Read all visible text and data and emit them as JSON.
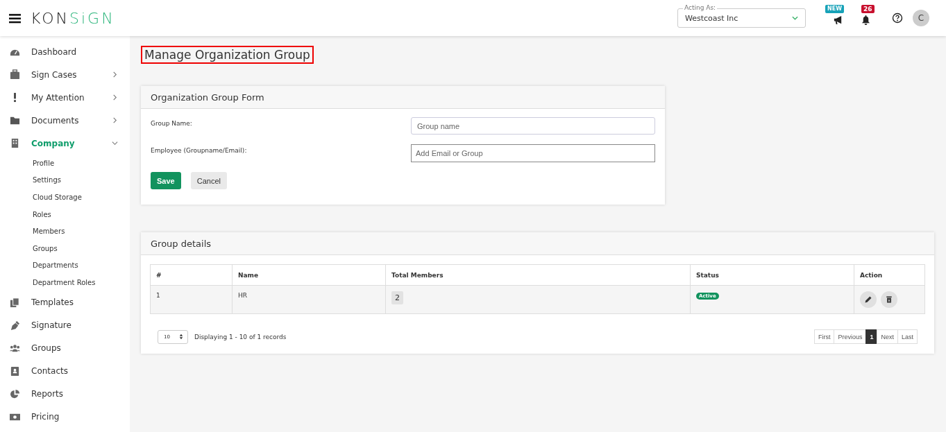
{
  "header": {
    "logo": {
      "dark": "KON",
      "accent": "SiGN"
    },
    "acting_as": {
      "label": "Acting As:",
      "value": "Westcoast Inc"
    },
    "announcement_badge": "NEW",
    "notification_count": "26",
    "avatar": "C"
  },
  "sidebar": {
    "items": [
      {
        "label": "Dashboard",
        "kind": "dashboard",
        "selected": false
      },
      {
        "label": "Sign Cases",
        "kind": "case",
        "expanded": false,
        "selected": false
      },
      {
        "label": "My Attention",
        "kind": "exclamation",
        "expanded": false,
        "selected": false
      },
      {
        "label": "Documents",
        "kind": "folder",
        "expanded": false,
        "selected": false
      },
      {
        "label": "Company",
        "kind": "building",
        "expanded": true,
        "selected": true,
        "children": [
          {
            "label": "Profile"
          },
          {
            "label": "Settings"
          },
          {
            "label": "Cloud Storage"
          },
          {
            "label": "Roles"
          },
          {
            "label": "Members"
          },
          {
            "label": "Groups"
          },
          {
            "label": "Departments"
          },
          {
            "label": "Department Roles"
          }
        ]
      },
      {
        "label": "Templates",
        "kind": "copy",
        "selected": false
      },
      {
        "label": "Signature",
        "kind": "pen",
        "selected": false
      },
      {
        "label": "Groups",
        "kind": "users",
        "selected": false
      },
      {
        "label": "Contacts",
        "kind": "contact",
        "selected": false
      },
      {
        "label": "Reports",
        "kind": "pie",
        "selected": false
      },
      {
        "label": "Pricing",
        "kind": "money",
        "selected": false
      }
    ]
  },
  "page_title": "Manage Organization Group",
  "form": {
    "title": "Organization Group Form",
    "fields": [
      {
        "label": "Group Name:",
        "placeholder": "Group name"
      },
      {
        "label": "Employee (Groupname/Email):",
        "placeholder": "Add Email or Group"
      }
    ],
    "buttons": [
      {
        "label": "Save",
        "kind": "primary"
      },
      {
        "label": "Cancel",
        "kind": "secondary"
      }
    ]
  },
  "group_details": {
    "title": "Group details",
    "table": {
      "columns": [
        "#",
        "Name",
        "Total Members",
        "Status",
        "Action"
      ],
      "rows": [
        {
          "index": "1",
          "name": "HR",
          "total_members": "2",
          "status": "Active"
        }
      ]
    },
    "page_size": "10",
    "summary": "Displaying 1 - 10 of 1 records",
    "pagination": [
      {
        "label": "First",
        "selected": false
      },
      {
        "label": "Previous",
        "selected": false
      },
      {
        "label": "1",
        "selected": true
      },
      {
        "label": "Next",
        "selected": false
      },
      {
        "label": "Last",
        "selected": false
      }
    ]
  }
}
